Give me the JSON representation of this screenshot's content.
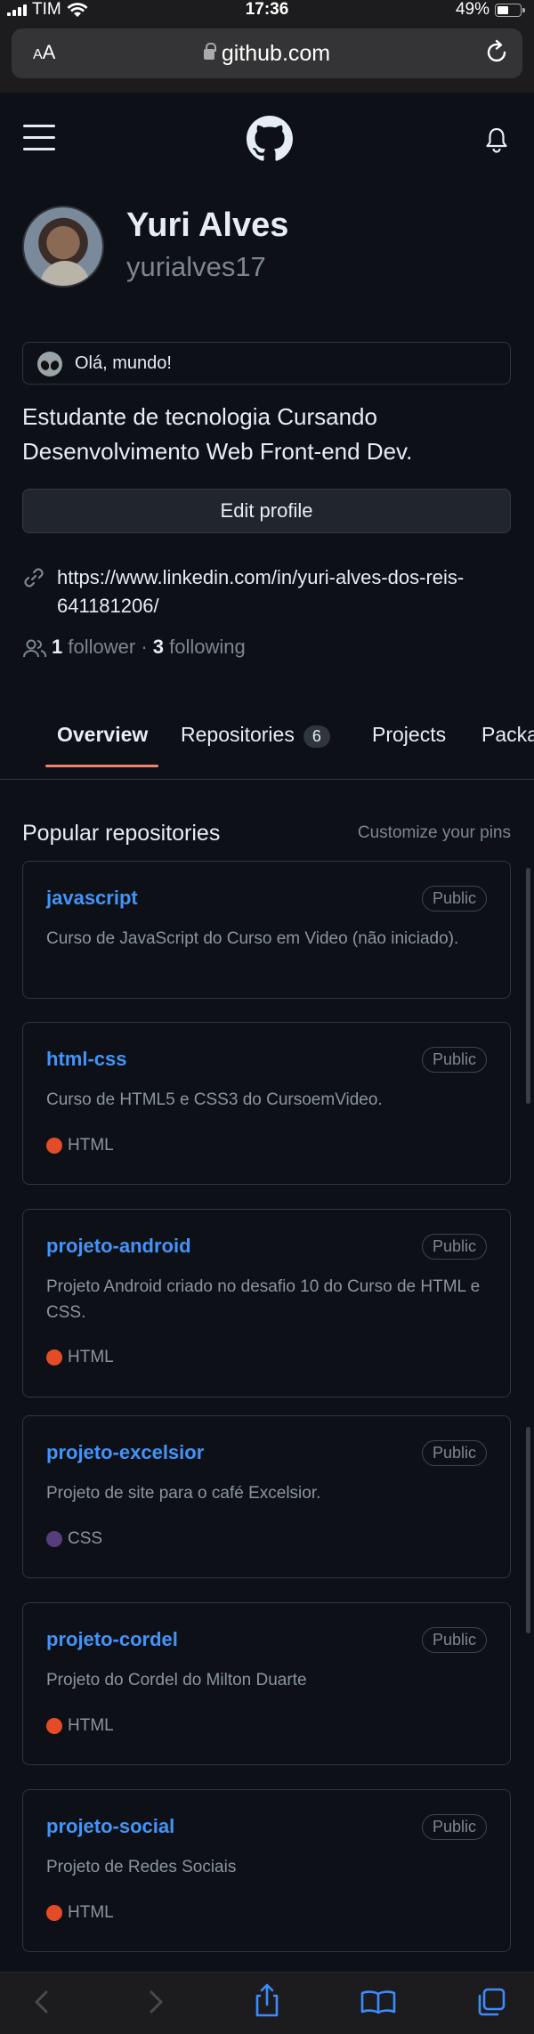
{
  "status_bar": {
    "carrier": "TIM",
    "time": "17:36",
    "battery": "49%"
  },
  "browser": {
    "text_size": "AA",
    "host": "github.com"
  },
  "profile": {
    "name": "Yuri Alves",
    "login": "yurialves17",
    "status": "Olá, mundo!",
    "bio": "Estudante de tecnologia Cursando Desenvolvimento Web Front-end Dev.",
    "edit_label": "Edit profile",
    "link": "https://www.linkedin.com/in/yuri-alves-dos-reis-641181206/",
    "followers_count": "1",
    "followers_label": "follower",
    "separator": "·",
    "following_count": "3",
    "following_label": "following"
  },
  "tabs": [
    {
      "label": "Overview",
      "selected": true
    },
    {
      "label": "Repositories",
      "count": "6"
    },
    {
      "label": "Projects"
    },
    {
      "label": "Packa"
    }
  ],
  "popular": {
    "title": "Popular repositories",
    "customize_label": "Customize your pins",
    "repos": [
      {
        "name": "javascript",
        "visibility": "Public",
        "description": "Curso de JavaScript do Curso em Video (não iniciado).",
        "language": "",
        "language_color": ""
      },
      {
        "name": "html-css",
        "visibility": "Public",
        "description": "Curso de HTML5 e CSS3 do CursoemVideo.",
        "language": "HTML",
        "language_color": "#e34c26"
      },
      {
        "name": "projeto-android",
        "visibility": "Public",
        "description": "Projeto Android criado no desafio 10 do Curso de HTML e CSS.",
        "language": "HTML",
        "language_color": "#e34c26"
      },
      {
        "name": "projeto-excelsior",
        "visibility": "Public",
        "description": "Projeto de site para o café Excelsior.",
        "language": "CSS",
        "language_color": "#563d7c"
      },
      {
        "name": "projeto-cordel",
        "visibility": "Public",
        "description": "Projeto do Cordel do Milton Duarte",
        "language": "HTML",
        "language_color": "#e34c26"
      },
      {
        "name": "projeto-social",
        "visibility": "Public",
        "description": "Projeto de Redes Sociais",
        "language": "HTML",
        "language_color": "#e34c26"
      }
    ]
  },
  "colors": {
    "accent_link": "#4493f8",
    "tab_underline": "#f78166",
    "background": "#0d1117"
  }
}
